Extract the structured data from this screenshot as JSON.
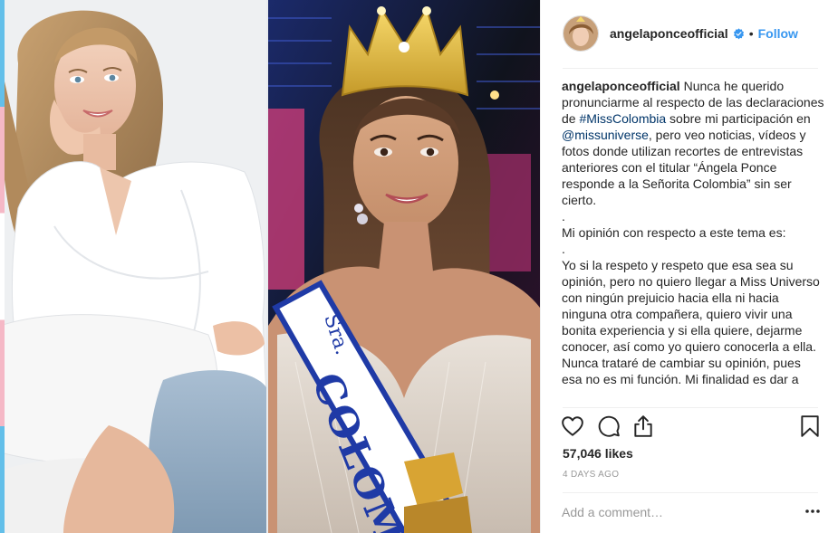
{
  "post": {
    "username": "angelaponceofficial",
    "follow_label": "Follow",
    "separator": "•",
    "caption": {
      "author": "angelaponceofficial",
      "segments": [
        {
          "text": " Nunca he querido pronunciarme al respecto de las declaraciones de ",
          "kind": "text"
        },
        {
          "text": "#MissColombia",
          "kind": "tag"
        },
        {
          "text": " sobre mi participación en ",
          "kind": "text"
        },
        {
          "text": "@missuniverse",
          "kind": "tag"
        },
        {
          "text": ", pero veo noticias, vídeos y fotos donde utilizan recortes de entrevistas anteriores con el titular “Ángela Ponce responde a la Señorita Colombia” sin ser cierto.\n.\nMi opinión con respecto a este tema es:\n.\nYo si la respeto y respeto que esa sea su opinión, pero no quiero llegar a Miss Universo con ningún prejuicio hacia ella ni hacia ninguna otra compañera, quiero vivir una bonita experiencia y si ella quiere, dejarme conocer, así como yo quiero conocerla a ella.\nNunca trataré de cambiar su opinión, pues esa no es mi función. Mi finalidad es dar a",
          "kind": "text"
        }
      ]
    },
    "likes": "57,046 likes",
    "time_ago": "4 DAYS AGO",
    "comment_placeholder": "Add a comment…",
    "image_text": {
      "sash": "Sra. COLOM"
    },
    "icons": {
      "like": "heart-icon",
      "comment": "comment-icon",
      "share": "share-icon",
      "save": "bookmark-icon",
      "verified": "verified-badge-icon",
      "more": "more-options-icon"
    },
    "colors": {
      "follow": "#3897f0",
      "tag": "#003569",
      "muted": "#999999",
      "verified": "#3897f0"
    }
  }
}
